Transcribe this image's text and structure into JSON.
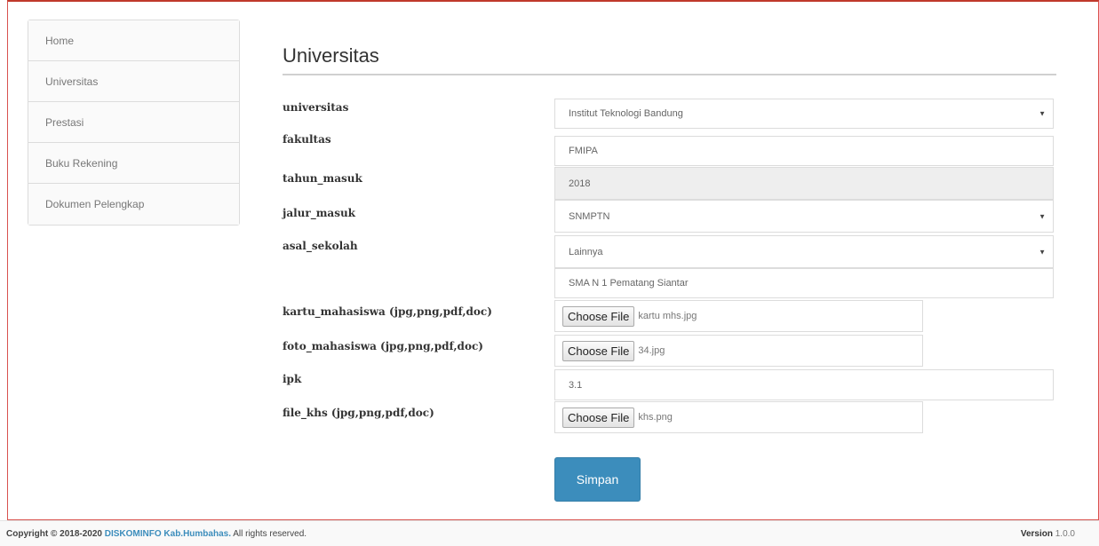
{
  "sidebar": {
    "items": [
      {
        "label": "Home"
      },
      {
        "label": "Universitas"
      },
      {
        "label": "Prestasi"
      },
      {
        "label": "Buku Rekening"
      },
      {
        "label": "Dokumen Pelengkap"
      }
    ]
  },
  "page": {
    "title": "Universitas"
  },
  "form": {
    "universitas": {
      "label": "universitas",
      "value": "Institut Teknologi Bandung"
    },
    "fakultas": {
      "label": "fakultas",
      "value": "FMIPA"
    },
    "tahun_masuk": {
      "label": "tahun_masuk",
      "value": "2018"
    },
    "jalur_masuk": {
      "label": "jalur_masuk",
      "value": "SNMPTN"
    },
    "asal_sekolah": {
      "label": "asal_sekolah",
      "value": "Lainnya",
      "other_value": "SMA N 1 Pematang Siantar"
    },
    "kartu_mahasiswa": {
      "label": "kartu_mahasiswa (jpg,png,pdf,doc)",
      "button": "Choose File",
      "file": "kartu mhs.jpg"
    },
    "foto_mahasiswa": {
      "label": "foto_mahasiswa (jpg,png,pdf,doc)",
      "button": "Choose File",
      "file": "34.jpg"
    },
    "ipk": {
      "label": "ipk",
      "value": "3.1"
    },
    "file_khs": {
      "label": "file_khs (jpg,png,pdf,doc)",
      "button": "Choose File",
      "file": "khs.png"
    },
    "submit_label": "Simpan"
  },
  "footer": {
    "copyright": "Copyright © 2018-2020",
    "org": "DISKOMINFO Kab.Humbahas.",
    "rights": "All rights reserved.",
    "version_label": "Version",
    "version": "1.0.0"
  },
  "colors": {
    "primary": "#3c8dbc",
    "frame_border": "#d9534f"
  }
}
